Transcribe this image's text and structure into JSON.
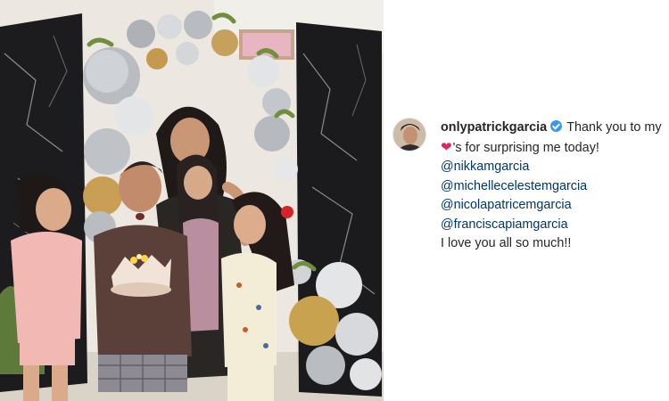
{
  "post": {
    "username": "onlypatrickgarcia",
    "caption_intro": "Thank you to my",
    "caption_heart_suffix": "'s for surprising me today!",
    "mentions": [
      "@nikkamgarcia",
      "@michellecelestemgarcia",
      "@nicolapatricemgarcia",
      "@franciscapiamgarcia"
    ],
    "closing": "I love you all so much!!"
  },
  "icons": {
    "verified": "verified-badge-icon",
    "heart": "red-heart-icon"
  },
  "colors": {
    "verified_blue": "#3897f0",
    "heart_red": "#e0245e",
    "mention_blue": "#00376b",
    "text": "#262626"
  }
}
